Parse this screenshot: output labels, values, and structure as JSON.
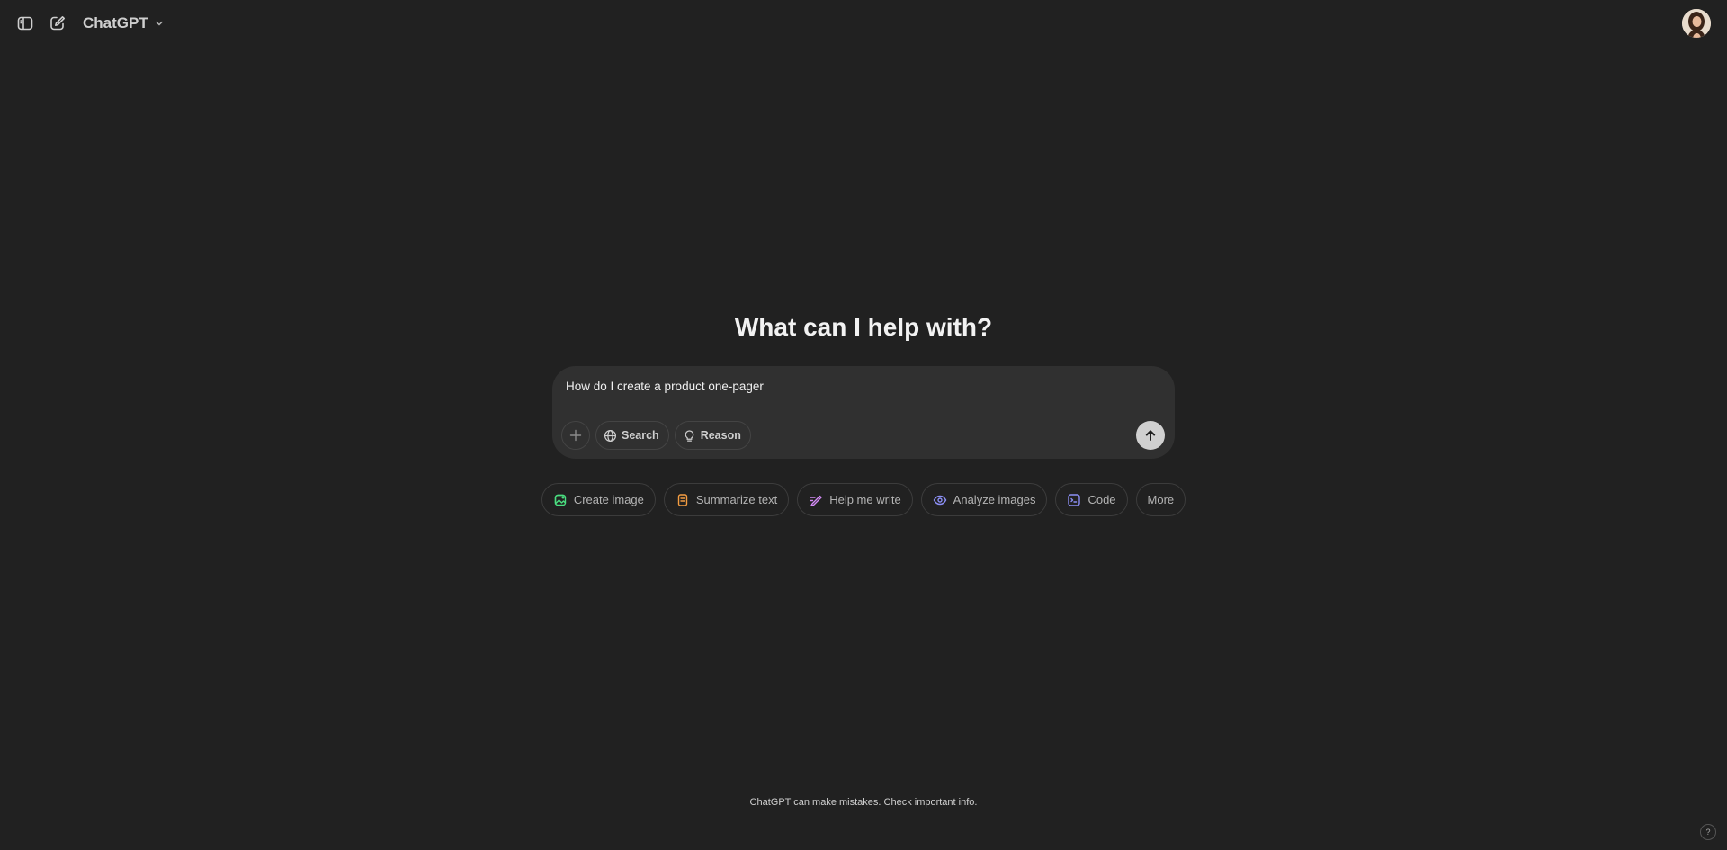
{
  "header": {
    "model_name": "ChatGPT"
  },
  "main": {
    "heading": "What can I help with?",
    "composer": {
      "value": "How do I create a product one-pager",
      "tools": [
        {
          "label": "Search",
          "icon": "globe-icon"
        },
        {
          "label": "Reason",
          "icon": "lightbulb-icon"
        }
      ]
    },
    "suggestions": [
      {
        "label": "Create image",
        "icon": "image-icon",
        "color": "#4ade80"
      },
      {
        "label": "Summarize text",
        "icon": "document-icon",
        "color": "#f59e42"
      },
      {
        "label": "Help me write",
        "icon": "pen-icon",
        "color": "#d38bf5"
      },
      {
        "label": "Analyze images",
        "icon": "eye-icon",
        "color": "#8c8ff5"
      },
      {
        "label": "Code",
        "icon": "code-icon",
        "color": "#8c8ff5"
      },
      {
        "label": "More"
      }
    ]
  },
  "footer": {
    "disclaimer": "ChatGPT can make mistakes. Check important info.",
    "help_label": "?"
  }
}
